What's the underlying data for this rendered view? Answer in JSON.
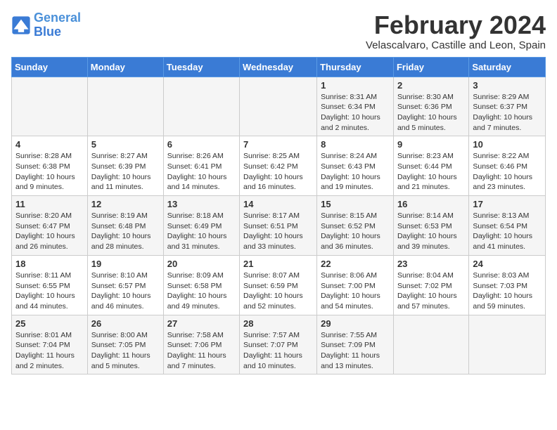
{
  "header": {
    "logo_general": "General",
    "logo_blue": "Blue",
    "month": "February 2024",
    "location": "Velascalvaro, Castille and Leon, Spain"
  },
  "weekdays": [
    "Sunday",
    "Monday",
    "Tuesday",
    "Wednesday",
    "Thursday",
    "Friday",
    "Saturday"
  ],
  "weeks": [
    [
      {
        "day": "",
        "info": ""
      },
      {
        "day": "",
        "info": ""
      },
      {
        "day": "",
        "info": ""
      },
      {
        "day": "",
        "info": ""
      },
      {
        "day": "1",
        "info": "Sunrise: 8:31 AM\nSunset: 6:34 PM\nDaylight: 10 hours\nand 2 minutes."
      },
      {
        "day": "2",
        "info": "Sunrise: 8:30 AM\nSunset: 6:36 PM\nDaylight: 10 hours\nand 5 minutes."
      },
      {
        "day": "3",
        "info": "Sunrise: 8:29 AM\nSunset: 6:37 PM\nDaylight: 10 hours\nand 7 minutes."
      }
    ],
    [
      {
        "day": "4",
        "info": "Sunrise: 8:28 AM\nSunset: 6:38 PM\nDaylight: 10 hours\nand 9 minutes."
      },
      {
        "day": "5",
        "info": "Sunrise: 8:27 AM\nSunset: 6:39 PM\nDaylight: 10 hours\nand 11 minutes."
      },
      {
        "day": "6",
        "info": "Sunrise: 8:26 AM\nSunset: 6:41 PM\nDaylight: 10 hours\nand 14 minutes."
      },
      {
        "day": "7",
        "info": "Sunrise: 8:25 AM\nSunset: 6:42 PM\nDaylight: 10 hours\nand 16 minutes."
      },
      {
        "day": "8",
        "info": "Sunrise: 8:24 AM\nSunset: 6:43 PM\nDaylight: 10 hours\nand 19 minutes."
      },
      {
        "day": "9",
        "info": "Sunrise: 8:23 AM\nSunset: 6:44 PM\nDaylight: 10 hours\nand 21 minutes."
      },
      {
        "day": "10",
        "info": "Sunrise: 8:22 AM\nSunset: 6:46 PM\nDaylight: 10 hours\nand 23 minutes."
      }
    ],
    [
      {
        "day": "11",
        "info": "Sunrise: 8:20 AM\nSunset: 6:47 PM\nDaylight: 10 hours\nand 26 minutes."
      },
      {
        "day": "12",
        "info": "Sunrise: 8:19 AM\nSunset: 6:48 PM\nDaylight: 10 hours\nand 28 minutes."
      },
      {
        "day": "13",
        "info": "Sunrise: 8:18 AM\nSunset: 6:49 PM\nDaylight: 10 hours\nand 31 minutes."
      },
      {
        "day": "14",
        "info": "Sunrise: 8:17 AM\nSunset: 6:51 PM\nDaylight: 10 hours\nand 33 minutes."
      },
      {
        "day": "15",
        "info": "Sunrise: 8:15 AM\nSunset: 6:52 PM\nDaylight: 10 hours\nand 36 minutes."
      },
      {
        "day": "16",
        "info": "Sunrise: 8:14 AM\nSunset: 6:53 PM\nDaylight: 10 hours\nand 39 minutes."
      },
      {
        "day": "17",
        "info": "Sunrise: 8:13 AM\nSunset: 6:54 PM\nDaylight: 10 hours\nand 41 minutes."
      }
    ],
    [
      {
        "day": "18",
        "info": "Sunrise: 8:11 AM\nSunset: 6:55 PM\nDaylight: 10 hours\nand 44 minutes."
      },
      {
        "day": "19",
        "info": "Sunrise: 8:10 AM\nSunset: 6:57 PM\nDaylight: 10 hours\nand 46 minutes."
      },
      {
        "day": "20",
        "info": "Sunrise: 8:09 AM\nSunset: 6:58 PM\nDaylight: 10 hours\nand 49 minutes."
      },
      {
        "day": "21",
        "info": "Sunrise: 8:07 AM\nSunset: 6:59 PM\nDaylight: 10 hours\nand 52 minutes."
      },
      {
        "day": "22",
        "info": "Sunrise: 8:06 AM\nSunset: 7:00 PM\nDaylight: 10 hours\nand 54 minutes."
      },
      {
        "day": "23",
        "info": "Sunrise: 8:04 AM\nSunset: 7:02 PM\nDaylight: 10 hours\nand 57 minutes."
      },
      {
        "day": "24",
        "info": "Sunrise: 8:03 AM\nSunset: 7:03 PM\nDaylight: 10 hours\nand 59 minutes."
      }
    ],
    [
      {
        "day": "25",
        "info": "Sunrise: 8:01 AM\nSunset: 7:04 PM\nDaylight: 11 hours\nand 2 minutes."
      },
      {
        "day": "26",
        "info": "Sunrise: 8:00 AM\nSunset: 7:05 PM\nDaylight: 11 hours\nand 5 minutes."
      },
      {
        "day": "27",
        "info": "Sunrise: 7:58 AM\nSunset: 7:06 PM\nDaylight: 11 hours\nand 7 minutes."
      },
      {
        "day": "28",
        "info": "Sunrise: 7:57 AM\nSunset: 7:07 PM\nDaylight: 11 hours\nand 10 minutes."
      },
      {
        "day": "29",
        "info": "Sunrise: 7:55 AM\nSunset: 7:09 PM\nDaylight: 11 hours\nand 13 minutes."
      },
      {
        "day": "",
        "info": ""
      },
      {
        "day": "",
        "info": ""
      }
    ]
  ]
}
